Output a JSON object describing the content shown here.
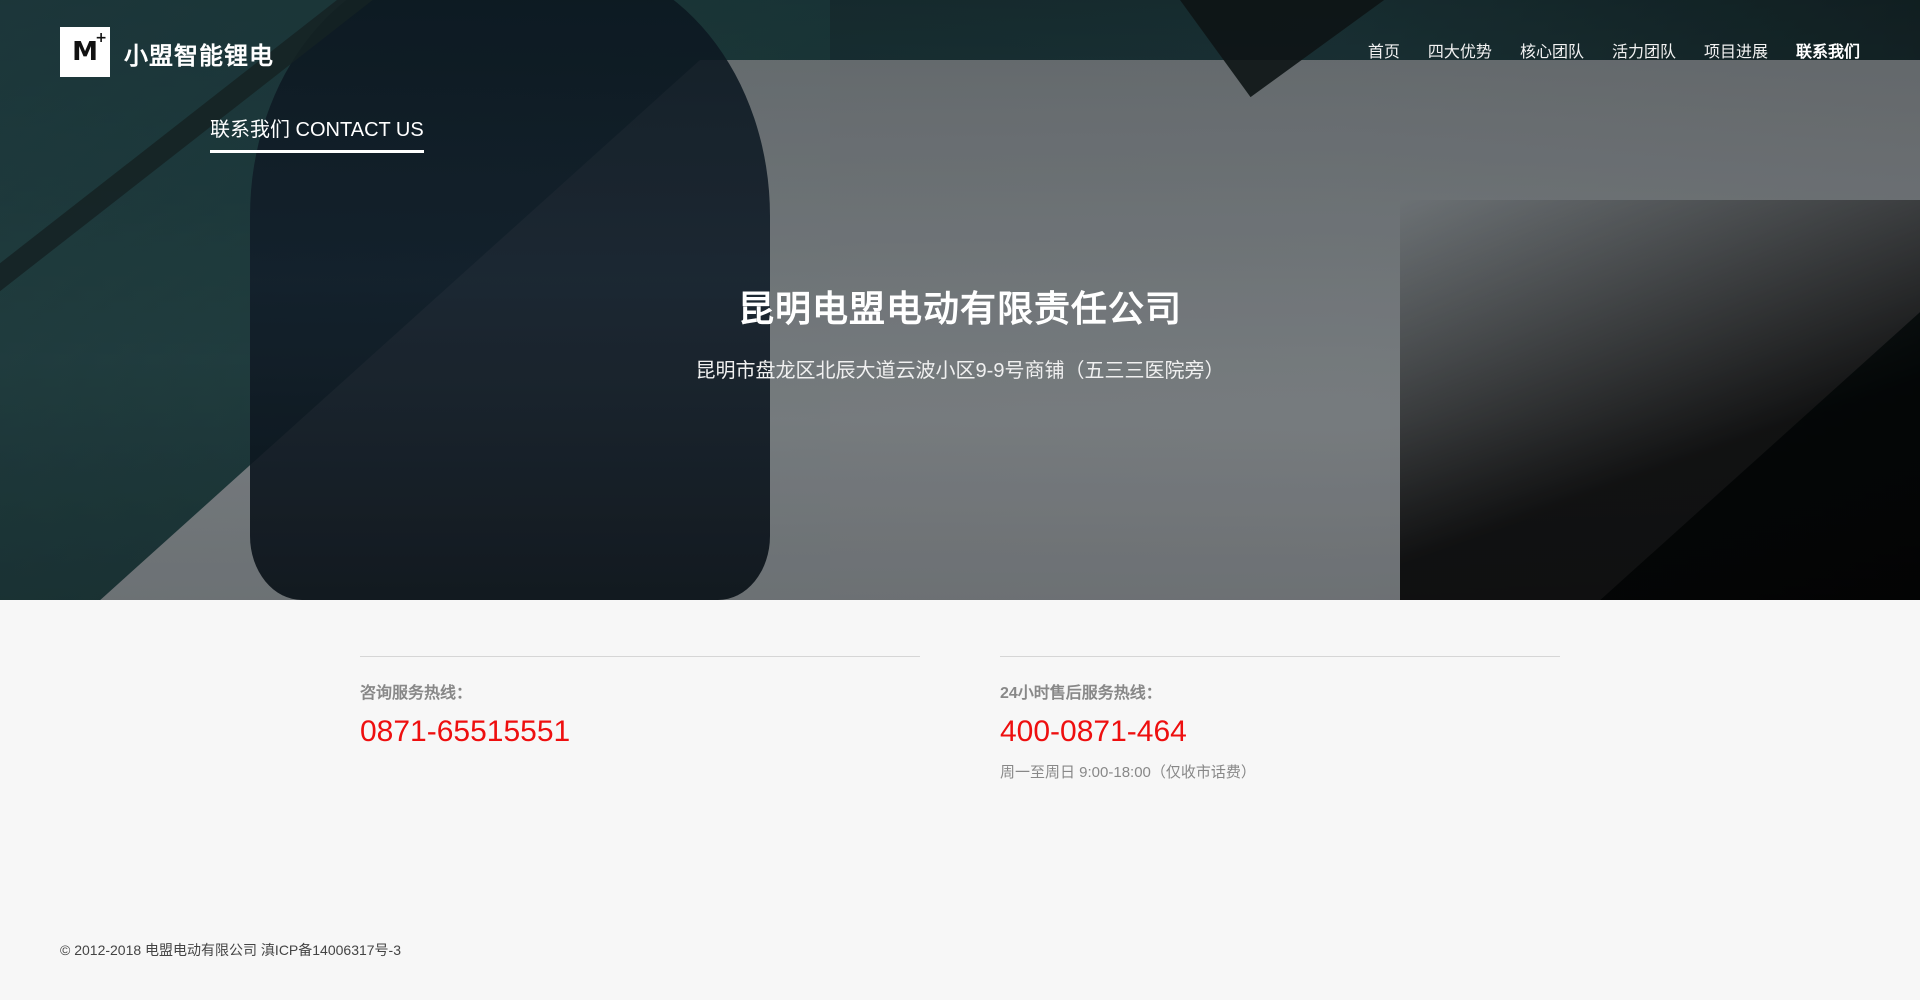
{
  "header": {
    "brand": "小盟智能锂电",
    "logo_text": "M",
    "logo_sup": "+",
    "nav": [
      {
        "label": "首页"
      },
      {
        "label": "四大优势"
      },
      {
        "label": "核心团队"
      },
      {
        "label": "活力团队"
      },
      {
        "label": "项目进展"
      },
      {
        "label": "联系我们",
        "active": true
      }
    ]
  },
  "hero": {
    "section_tag": "联系我们 CONTACT US",
    "company": "昆明电盟电动有限责任公司",
    "address": "昆明市盘龙区北辰大道云波小区9-9号商铺（五三三医院旁）"
  },
  "contacts": {
    "consult": {
      "label": "咨询服务热线：",
      "phone": "0871-65515551"
    },
    "aftersales": {
      "label": "24小时售后服务热线：",
      "phone": "400-0871-464",
      "hours": "周一至周日 9:00-18:00（仅收市话费）"
    }
  },
  "footer": {
    "copyright": "© 2012-2018 电盟电动有限公司 滇ICP备14006317号-3"
  },
  "colors": {
    "accent_phone": "#ee0f0f",
    "page_bg": "#f7f7f7"
  }
}
